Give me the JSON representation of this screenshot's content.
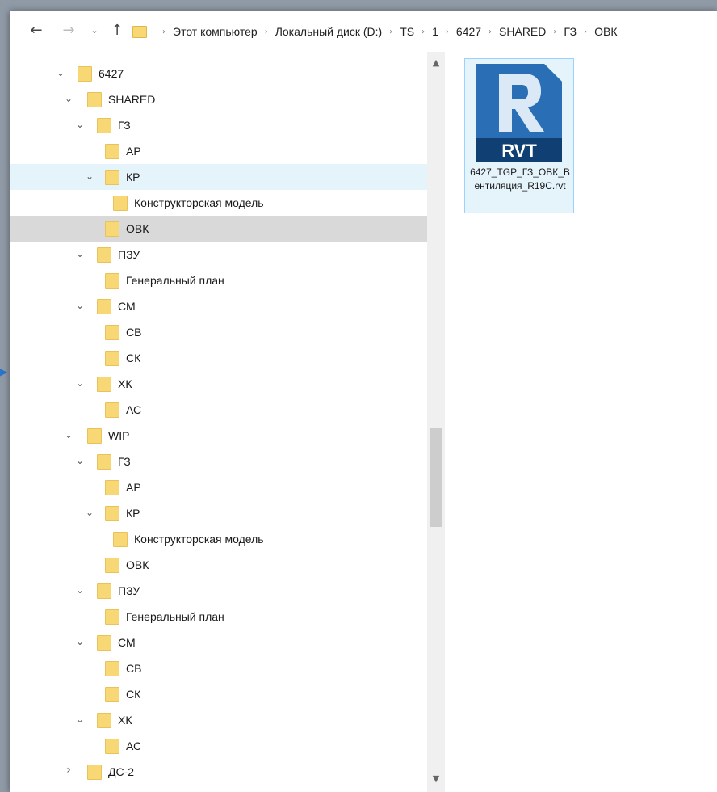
{
  "nav": {
    "back_icon": "←",
    "forward_icon": "→",
    "history_icon": "⌄",
    "up_icon": "↑"
  },
  "breadcrumb": [
    "Этот компьютер",
    "Локальный диск (D:)",
    "TS",
    "1",
    "6427",
    "SHARED",
    "ГЗ",
    "ОВК"
  ],
  "tree": [
    {
      "label": "6427",
      "expanded": true,
      "level": 1
    },
    {
      "label": "SHARED",
      "expanded": true,
      "level": 2
    },
    {
      "label": "ГЗ",
      "expanded": true,
      "level": 3
    },
    {
      "label": "АР",
      "expanded": null,
      "level": 4
    },
    {
      "label": "КР",
      "expanded": true,
      "level": 4,
      "state": "hover"
    },
    {
      "label": "Конструкторская модель",
      "expanded": null,
      "level": 5
    },
    {
      "label": "ОВК",
      "expanded": null,
      "level": 4,
      "state": "selected"
    },
    {
      "label": "ПЗУ",
      "expanded": true,
      "level": 3
    },
    {
      "label": "Генеральный план",
      "expanded": null,
      "level": 4
    },
    {
      "label": "СМ",
      "expanded": true,
      "level": 3
    },
    {
      "label": "СВ",
      "expanded": null,
      "level": 4
    },
    {
      "label": "СК",
      "expanded": null,
      "level": 4
    },
    {
      "label": "ХК",
      "expanded": true,
      "level": 3
    },
    {
      "label": "АС",
      "expanded": null,
      "level": 4
    },
    {
      "label": "WIP",
      "expanded": true,
      "level": 2
    },
    {
      "label": "ГЗ",
      "expanded": true,
      "level": 3
    },
    {
      "label": "АР",
      "expanded": null,
      "level": 4
    },
    {
      "label": "КР",
      "expanded": true,
      "level": 4
    },
    {
      "label": "Конструкторская модель",
      "expanded": null,
      "level": 5
    },
    {
      "label": "ОВК",
      "expanded": null,
      "level": 4
    },
    {
      "label": "ПЗУ",
      "expanded": true,
      "level": 3
    },
    {
      "label": "Генеральный план",
      "expanded": null,
      "level": 4
    },
    {
      "label": "СМ",
      "expanded": true,
      "level": 3
    },
    {
      "label": "СВ",
      "expanded": null,
      "level": 4
    },
    {
      "label": "СК",
      "expanded": null,
      "level": 4
    },
    {
      "label": "ХК",
      "expanded": true,
      "level": 3
    },
    {
      "label": "АС",
      "expanded": null,
      "level": 4
    },
    {
      "label": "ДС-2",
      "expanded": false,
      "level": 2
    }
  ],
  "files": [
    {
      "icon_text": "RVT",
      "name": "6427_TGP_ГЗ_ОВК_Вентиляция_R19C.rvt"
    }
  ],
  "colors": {
    "folder": "#f8d775",
    "hover": "#e5f3fb",
    "selected": "#d9d9d9",
    "revit_blue": "#1b5fa3"
  }
}
